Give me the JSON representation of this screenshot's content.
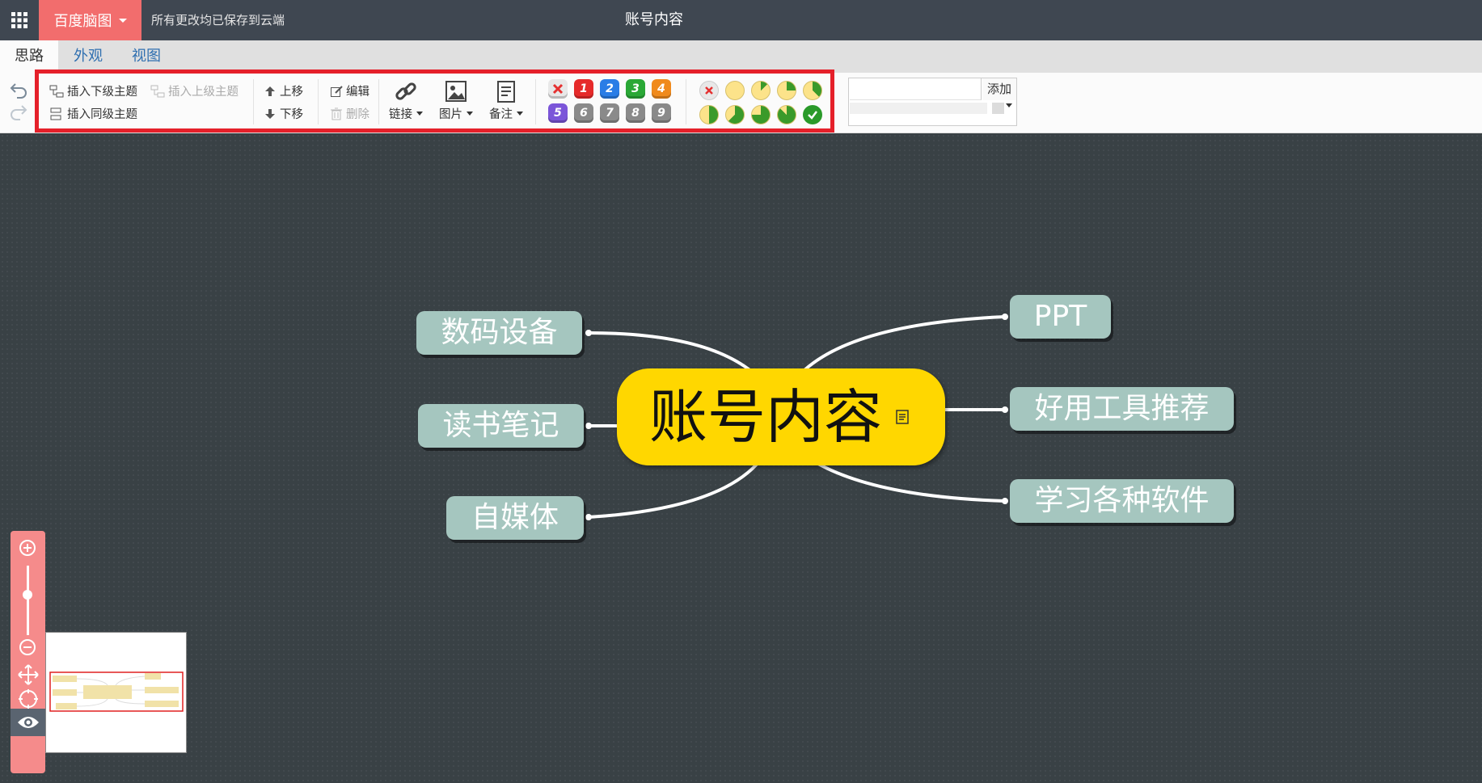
{
  "header": {
    "brand": "百度脑图",
    "save_status": "所有更改均已保存到云端",
    "title": "账号内容"
  },
  "tabs": [
    {
      "label": "思路",
      "active": true
    },
    {
      "label": "外观",
      "active": false
    },
    {
      "label": "视图",
      "active": false
    }
  ],
  "toolbar": {
    "insert_child": "插入下级主题",
    "insert_parent": "插入上级主题",
    "insert_sibling": "插入同级主题",
    "move_up": "上移",
    "move_down": "下移",
    "edit": "编辑",
    "delete": "删除",
    "link": "链接",
    "image": "图片",
    "note": "备注"
  },
  "priority": {
    "labels": [
      "1",
      "2",
      "3",
      "4",
      "5",
      "6",
      "7",
      "8",
      "9"
    ],
    "colors": [
      "#e62a2a",
      "#2a7de6",
      "#2aa836",
      "#f08a1c",
      "#7b55d9",
      "#8a8a8a",
      "#8a8a8a",
      "#8a8a8a",
      "#8a8a8a"
    ]
  },
  "progress": {
    "fractions": [
      0,
      0.125,
      0.25,
      0.375,
      0.5,
      0.625,
      0.75,
      0.875,
      1
    ]
  },
  "resource": {
    "input_value": "",
    "add_label": "添加"
  },
  "mindmap": {
    "root": "账号内容",
    "left": [
      "数码设备",
      "读书笔记",
      "自媒体"
    ],
    "right": [
      "PPT",
      "好用工具推荐",
      "学习各种软件"
    ]
  },
  "colors": {
    "topbar": "#3f4751",
    "brand": "#f26d6d",
    "root": "#ffd700",
    "child": "#a5c6bf",
    "canvas": "#394145",
    "highlight": "#e5202a"
  }
}
